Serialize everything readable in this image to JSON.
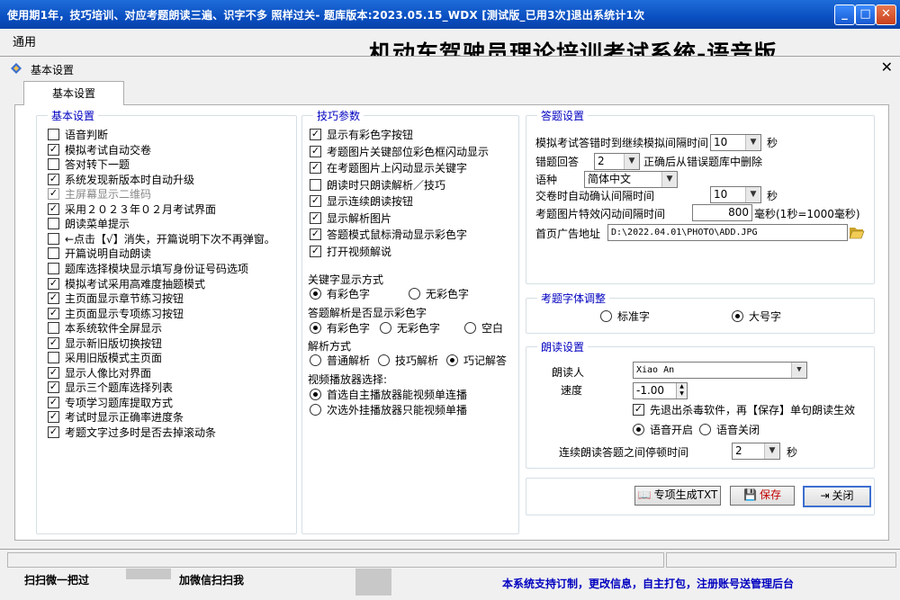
{
  "window": {
    "title": "使用期1年，技巧培训、对应考题朗读三遍、识字不多 照样过关-   题库版本:2023.05.15_WDX [测试版_已用3次]退出系统计1次",
    "min_label": "_",
    "max_label": "□",
    "close_label": "✕"
  },
  "menubar": {
    "item": "通用"
  },
  "app_heading": "机动车驾驶员理论培训考试系统-语音版",
  "dialog": {
    "title": "基本设置",
    "close_label": "✕",
    "tab_label": "基本设置"
  },
  "basic": {
    "legend": "基本设置",
    "items": [
      {
        "label": "语音判断",
        "checked": false,
        "disabled": false
      },
      {
        "label": "模拟考试自动交卷",
        "checked": true,
        "disabled": false
      },
      {
        "label": "答对转下一题",
        "checked": false,
        "disabled": false
      },
      {
        "label": "系统发现新版本时自动升级",
        "checked": true,
        "disabled": false
      },
      {
        "label": "主屏幕显示二维码",
        "checked": true,
        "disabled": true
      },
      {
        "label": "采用２０２３年０２月考试界面",
        "checked": true,
        "disabled": false
      },
      {
        "label": "朗读菜单提示",
        "checked": false,
        "disabled": false
      },
      {
        "label": "←点击【√】消失，开篇说明下次不再弹窗。",
        "checked": false,
        "disabled": false
      },
      {
        "label": "开篇说明自动朗读",
        "checked": false,
        "disabled": false
      },
      {
        "label": "题库选择模块显示填写身份证号码选项",
        "checked": false,
        "disabled": false
      },
      {
        "label": "模拟考试采用高难度抽题模式",
        "checked": true,
        "disabled": false
      },
      {
        "label": "主页面显示章节练习按钮",
        "checked": true,
        "disabled": false
      },
      {
        "label": "主页面显示专项练习按钮",
        "checked": true,
        "disabled": false
      },
      {
        "label": "本系统软件全屏显示",
        "checked": false,
        "disabled": false
      },
      {
        "label": "显示新旧版切换按钮",
        "checked": true,
        "disabled": false
      },
      {
        "label": "采用旧版模式主页面",
        "checked": false,
        "disabled": false
      },
      {
        "label": "显示人像比对界面",
        "checked": true,
        "disabled": false
      },
      {
        "label": "显示三个题库选择列表",
        "checked": true,
        "disabled": false
      },
      {
        "label": "专项学习题库提取方式",
        "checked": true,
        "disabled": false
      },
      {
        "label": "考试时显示正确率进度条",
        "checked": true,
        "disabled": false
      },
      {
        "label": "考题文字过多时是否去掉滚动条",
        "checked": true,
        "disabled": false
      }
    ]
  },
  "skills": {
    "legend": "技巧参数",
    "items": [
      {
        "label": "显示有彩色字按钮",
        "checked": true
      },
      {
        "label": "考题图片关键部位彩色框闪动显示",
        "checked": true
      },
      {
        "label": "在考题图片上闪动显示关键字",
        "checked": true
      },
      {
        "label": "朗读时只朗读解析／技巧",
        "checked": false
      },
      {
        "label": "显示连续朗读按钮",
        "checked": true
      },
      {
        "label": "显示解析图片",
        "checked": true
      },
      {
        "label": "答题模式鼠标滑动显示彩色字",
        "checked": true
      },
      {
        "label": "打开视频解说",
        "checked": true
      }
    ],
    "keyword_title": "关键字显示方式",
    "keyword_opts": [
      "有彩色字",
      "无彩色字"
    ],
    "keyword_sel": 0,
    "analysis_color_title": "答题解析是否显示彩色字",
    "analysis_color_opts": [
      "有彩色字",
      "无彩色字",
      "空白"
    ],
    "analysis_color_sel": 0,
    "analysis_mode_title": "解析方式",
    "analysis_mode_opts": [
      "普通解析",
      "技巧解析",
      "巧记解答"
    ],
    "analysis_mode_sel": 2,
    "player_title": "视频播放器选择:",
    "player_opts": [
      "首选自主播放器能视频单连播",
      "次选外挂播放器只能视频单播"
    ],
    "player_sel": 0
  },
  "answer": {
    "legend": "答题设置",
    "interval_label": "模拟考试答错时到继续模拟间隔时间",
    "interval_value": "10",
    "interval_unit": "秒",
    "wrong_label": "错题回答",
    "wrong_value": "2",
    "wrong_suffix": "正确后从错误题库中删除",
    "lang_label": "语种",
    "lang_value": "简体中文",
    "submit_label": "交卷时自动确认间隔时间",
    "submit_value": "10",
    "submit_unit": "秒",
    "flash_label": "考题图片特效闪动间隔时间",
    "flash_value": "800",
    "flash_unit": "毫秒(1秒=1000毫秒)",
    "ad_label": "首页广告地址",
    "ad_value": "D:\\2022.04.01\\PHOTO\\ADD.JPG"
  },
  "font": {
    "legend": "考题字体调整",
    "opts": [
      "标准字",
      "大号字"
    ],
    "sel": 1
  },
  "reading": {
    "legend": "朗读设置",
    "reader_label": "朗读人",
    "reader_value": "Xiao An",
    "speed_label": "速度",
    "speed_value": "-1.00",
    "exit_label": "先退出杀毒软件，再【保存】单句朗读生效",
    "exit_checked": true,
    "voice_opts": [
      "语音开启",
      "语音关闭"
    ],
    "voice_sel": 0,
    "pause_label": "连续朗读答题之间停顿时间",
    "pause_value": "2",
    "pause_unit": "秒"
  },
  "buttons": {
    "txt": "专项生成TXT",
    "save": "保存",
    "close": "关闭"
  },
  "footer": {
    "left1": "扫扫微一把过",
    "left2": "加微信扫扫我",
    "right": "本系统支持订制，更改信息，自主打包，注册账号送管理后台"
  },
  "colors": {
    "title_bar": "#0a4fc2",
    "legend": "#0000c0",
    "footer_text": "#0000c0",
    "save_text": "#c00000"
  }
}
